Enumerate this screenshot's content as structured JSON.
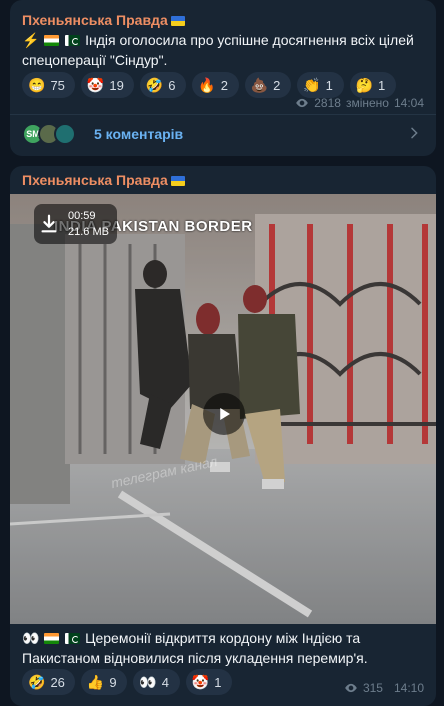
{
  "posts": [
    {
      "channel": "Пхеньянська Правда",
      "text": "Індія оголосила про успішне досягнення всіх цілей спецоперації \"Сіндур\".",
      "reactions": [
        {
          "emoji": "😁",
          "count": "75"
        },
        {
          "emoji": "🤡",
          "count": "19"
        },
        {
          "emoji": "🤣",
          "count": "6"
        },
        {
          "emoji": "🔥",
          "count": "2"
        },
        {
          "emoji": "💩",
          "count": "2"
        },
        {
          "emoji": "👏",
          "count": "1"
        },
        {
          "emoji": "🤔",
          "count": "1"
        }
      ],
      "views": "2818",
      "edited": "змінено",
      "time": "14:04",
      "comments": {
        "label": "5 коментарів",
        "avatar_initials": "SM"
      }
    },
    {
      "channel": "Пхеньянська Правда",
      "video": {
        "duration": "00:59",
        "size": "21.6 MB",
        "caption": "INDIA PAKISTAN BORDER",
        "watermark": "телеграм канал"
      },
      "text": "Церемонії відкриття кордону між Індією та Пакистаном відновилися після укладення перемир'я.",
      "reactions": [
        {
          "emoji": "🤣",
          "count": "26"
        },
        {
          "emoji": "👍",
          "count": "9"
        },
        {
          "emoji": "👀",
          "count": "4"
        },
        {
          "emoji": "🤡",
          "count": "1"
        }
      ],
      "views": "315",
      "time": "14:10"
    }
  ],
  "colors": {
    "background": "#0e1621",
    "bubble": "#182533",
    "channel_name": "#ee8e63",
    "link": "#6ab2f2",
    "meta": "#6d7d8c"
  }
}
